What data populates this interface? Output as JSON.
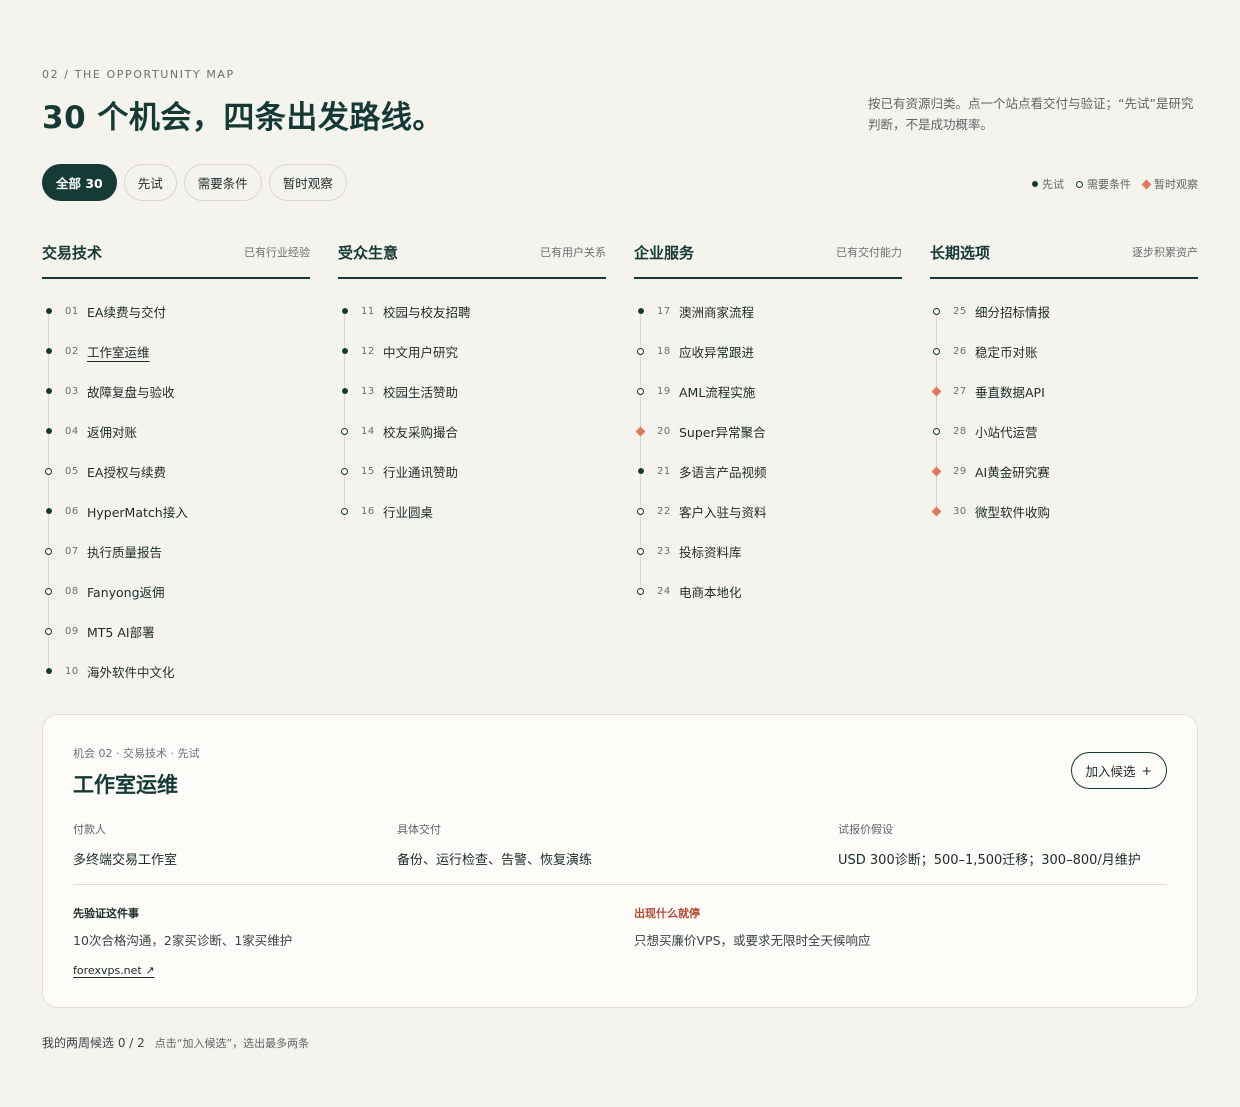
{
  "header": {
    "eyebrow": "02 / THE OPPORTUNITY MAP",
    "title": "30 个机会，四条出发路线。",
    "intro": "按已有资源归类。点一个站点看交付与验证；“先试”是研究判断，不是成功概率。"
  },
  "filters": [
    {
      "label": "全部 30",
      "active": true
    },
    {
      "label": "先试",
      "active": false
    },
    {
      "label": "需要条件",
      "active": false
    },
    {
      "label": "暂时观察",
      "active": false
    }
  ],
  "legend": [
    {
      "label": "先试",
      "marker": "filled"
    },
    {
      "label": "需要条件",
      "marker": "hollow"
    },
    {
      "label": "暂时观察",
      "marker": "diamond"
    }
  ],
  "colors": {
    "primary": "#163b37",
    "accent": "#e07a5f",
    "stop": "#b94a34",
    "background": "#f5f3ee",
    "card": "#fdfcf8"
  },
  "columns": [
    {
      "title": "交易技术",
      "subtitle": "已有行业经验",
      "items": [
        {
          "num": "01",
          "label": "EA续费与交付",
          "status": "filled"
        },
        {
          "num": "02",
          "label": "工作室运维",
          "status": "filled",
          "selected": true
        },
        {
          "num": "03",
          "label": "故障复盘与验收",
          "status": "filled"
        },
        {
          "num": "04",
          "label": "返佣对账",
          "status": "filled"
        },
        {
          "num": "05",
          "label": "EA授权与续费",
          "status": "hollow"
        },
        {
          "num": "06",
          "label": "HyperMatch接入",
          "status": "filled"
        },
        {
          "num": "07",
          "label": "执行质量报告",
          "status": "hollow"
        },
        {
          "num": "08",
          "label": "Fanyong返佣",
          "status": "hollow"
        },
        {
          "num": "09",
          "label": "MT5 AI部署",
          "status": "hollow"
        },
        {
          "num": "10",
          "label": "海外软件中文化",
          "status": "filled"
        }
      ]
    },
    {
      "title": "受众生意",
      "subtitle": "已有用户关系",
      "items": [
        {
          "num": "11",
          "label": "校园与校友招聘",
          "status": "filled"
        },
        {
          "num": "12",
          "label": "中文用户研究",
          "status": "filled"
        },
        {
          "num": "13",
          "label": "校园生活赞助",
          "status": "filled"
        },
        {
          "num": "14",
          "label": "校友采购撮合",
          "status": "hollow"
        },
        {
          "num": "15",
          "label": "行业通讯赞助",
          "status": "hollow"
        },
        {
          "num": "16",
          "label": "行业圆桌",
          "status": "hollow"
        }
      ]
    },
    {
      "title": "企业服务",
      "subtitle": "已有交付能力",
      "items": [
        {
          "num": "17",
          "label": "澳洲商家流程",
          "status": "filled"
        },
        {
          "num": "18",
          "label": "应收异常跟进",
          "status": "hollow"
        },
        {
          "num": "19",
          "label": "AML流程实施",
          "status": "hollow"
        },
        {
          "num": "20",
          "label": "Super异常聚合",
          "status": "diamond"
        },
        {
          "num": "21",
          "label": "多语言产品视频",
          "status": "filled"
        },
        {
          "num": "22",
          "label": "客户入驻与资料",
          "status": "hollow"
        },
        {
          "num": "23",
          "label": "投标资料库",
          "status": "hollow"
        },
        {
          "num": "24",
          "label": "电商本地化",
          "status": "hollow"
        }
      ]
    },
    {
      "title": "长期选项",
      "subtitle": "逐步积累资产",
      "items": [
        {
          "num": "25",
          "label": "细分招标情报",
          "status": "hollow"
        },
        {
          "num": "26",
          "label": "稳定币对账",
          "status": "hollow"
        },
        {
          "num": "27",
          "label": "垂直数据API",
          "status": "diamond"
        },
        {
          "num": "28",
          "label": "小站代运营",
          "status": "hollow"
        },
        {
          "num": "29",
          "label": "AI黄金研究赛",
          "status": "diamond"
        },
        {
          "num": "30",
          "label": "微型软件收购",
          "status": "diamond"
        }
      ]
    }
  ],
  "detail": {
    "crumb": "机会 02 · 交易技术 · 先试",
    "title": "工作室运维",
    "add_label": "加入候选",
    "add_icon": "+",
    "payer_label": "付款人",
    "payer": "多终端交易工作室",
    "delivery_label": "具体交付",
    "delivery": "备份、运行检查、告警、恢复演练",
    "price_label": "试报价假设",
    "price": "USD 300诊断；500–1,500迁移；300–800/月维护",
    "validate_label": "先验证这件事",
    "validate": "10次合格沟通，2家买诊断、1家买维护",
    "stop_label": "出现什么就停",
    "stop": "只想买廉价VPS，或要求无限时全天候响应",
    "link": "forexvps.net ↗"
  },
  "shortlist": {
    "label": "我的两周候选 0 / 2",
    "hint": "点击“加入候选”，选出最多两条"
  }
}
